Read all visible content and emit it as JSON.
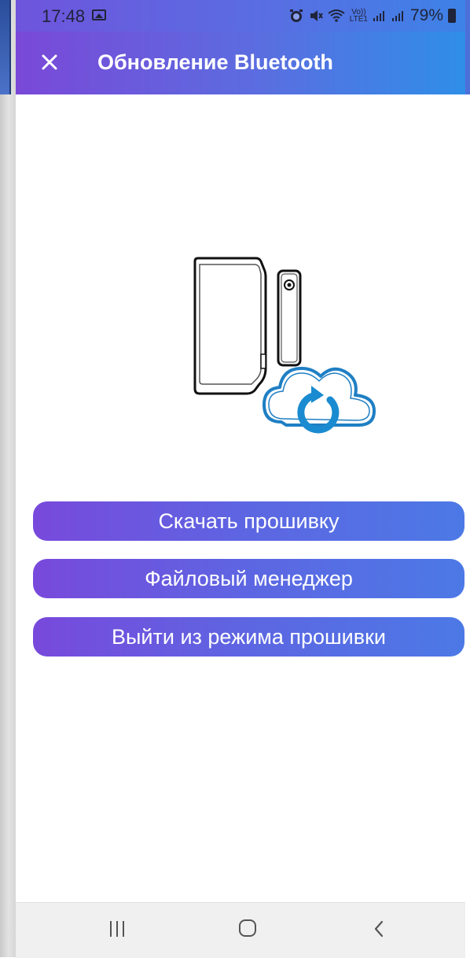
{
  "status_bar": {
    "time": "17:48",
    "battery_percent": "79%",
    "network_label_top": "Vo))",
    "network_label_bottom": "LTE1"
  },
  "header": {
    "title": "Обновление Bluetooth"
  },
  "buttons": {
    "download_firmware": "Скачать прошивку",
    "file_manager": "Файловый менеджер",
    "exit_firmware_mode": "Выйти из режима прошивки"
  },
  "colors": {
    "gradient_start": "#7a48d8",
    "gradient_end": "#2f8ee8",
    "button_start": "#7849dc",
    "button_end": "#4c79e6",
    "cloud_blue": "#1f7fc4"
  },
  "icons": {
    "close": "close-icon",
    "device": "sensor-device-icon",
    "cloud_update": "cloud-refresh-icon",
    "nav_recents": "recents-icon",
    "nav_home": "home-icon",
    "nav_back": "back-icon"
  }
}
